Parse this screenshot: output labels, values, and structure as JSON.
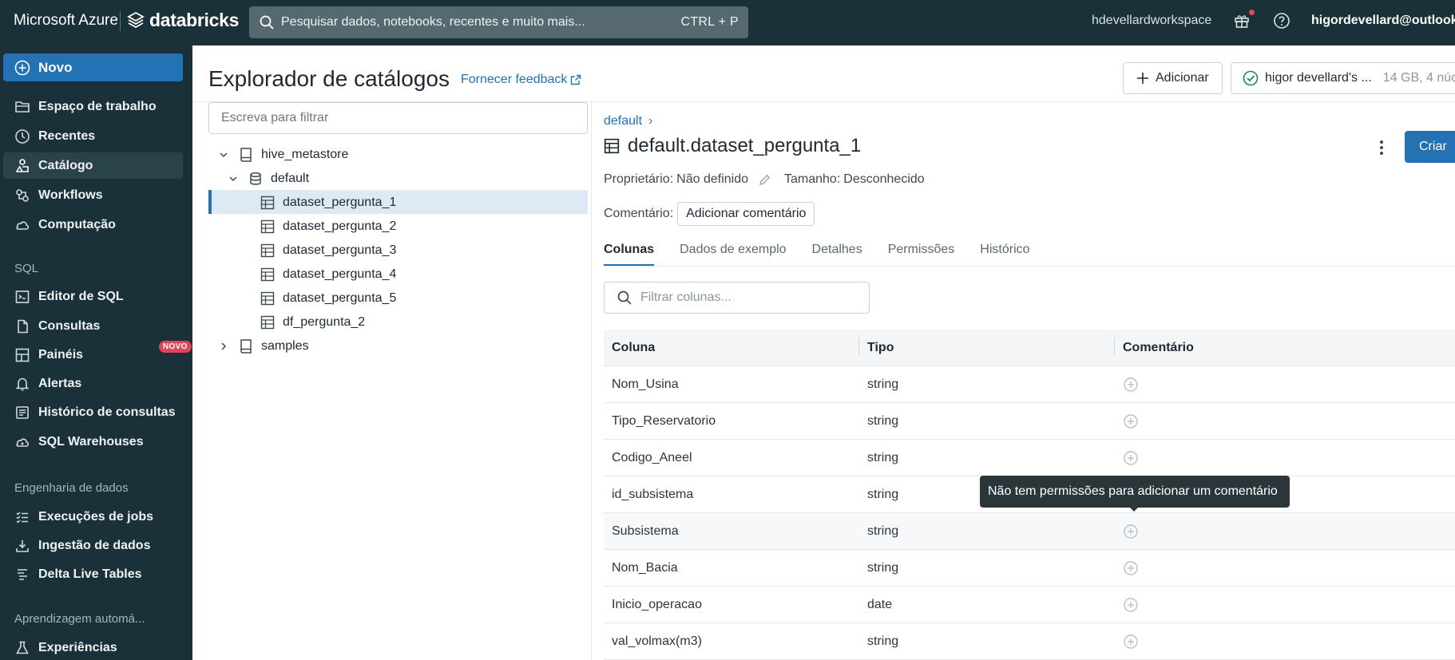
{
  "topbar": {
    "brand_ms": "Microsoft Azure",
    "brand_db": "databricks",
    "search_placeholder": "Pesquisar dados, notebooks, recentes e muito mais...",
    "search_shortcut": "CTRL + P",
    "workspace": "hdevellardworkspace",
    "user": "higordevellard@outlook"
  },
  "sidebar": {
    "new_label": "Novo",
    "items": [
      {
        "label": "Espaço de trabalho",
        "icon": "folder-icon"
      },
      {
        "label": "Recentes",
        "icon": "clock-icon"
      },
      {
        "label": "Catálogo",
        "icon": "catalog-icon",
        "active": true
      },
      {
        "label": "Workflows",
        "icon": "workflows-icon"
      },
      {
        "label": "Computação",
        "icon": "cloud-icon"
      }
    ],
    "sql_section": "SQL",
    "sql_items": [
      {
        "label": "Editor de SQL",
        "icon": "sql-editor-icon"
      },
      {
        "label": "Consultas",
        "icon": "file-icon"
      },
      {
        "label": "Painéis",
        "icon": "dashboard-icon",
        "badge": "NOVO"
      },
      {
        "label": "Alertas",
        "icon": "bell-icon"
      },
      {
        "label": "Histórico de consultas",
        "icon": "history-icon"
      },
      {
        "label": "SQL Warehouses",
        "icon": "warehouse-icon"
      }
    ],
    "de_section": "Engenharia de dados",
    "de_items": [
      {
        "label": "Execuções de jobs",
        "icon": "jobs-icon"
      },
      {
        "label": "Ingestão de dados",
        "icon": "ingest-icon"
      },
      {
        "label": "Delta Live Tables",
        "icon": "delta-icon"
      }
    ],
    "ml_section": "Aprendizagem automá...",
    "ml_items": [
      {
        "label": "Experiências",
        "icon": "flask-icon"
      }
    ]
  },
  "page": {
    "title": "Explorador de catálogos",
    "feedback": "Fornecer feedback",
    "add_button": "Adicionar",
    "cluster_name": "higor devellard's ...",
    "cluster_size": "14 GB, 4 núc"
  },
  "tree": {
    "filter_placeholder": "Escreva para filtrar",
    "nodes": [
      {
        "label": "hive_metastore"
      },
      {
        "label": "default"
      },
      {
        "label": "dataset_pergunta_1"
      },
      {
        "label": "dataset_pergunta_2"
      },
      {
        "label": "dataset_pergunta_3"
      },
      {
        "label": "dataset_pergunta_4"
      },
      {
        "label": "dataset_pergunta_5"
      },
      {
        "label": "df_pergunta_2"
      },
      {
        "label": "samples"
      }
    ]
  },
  "detail": {
    "breadcrumb": "default",
    "breadcrumb_sep": "›",
    "table_name": "default.dataset_pergunta_1",
    "create_button": "Criar",
    "owner_label": "Proprietário:",
    "owner_value": "Não definido",
    "size_label": "Tamanho:",
    "size_value": "Desconhecido",
    "comment_label": "Comentário:",
    "comment_button": "Adicionar comentário",
    "tabs": [
      "Colunas",
      "Dados de exemplo",
      "Detalhes",
      "Permissões",
      "Histórico"
    ],
    "column_filter_placeholder": "Filtrar colunas...",
    "columns_header": {
      "col": "Coluna",
      "type": "Tipo",
      "comment": "Comentário"
    },
    "columns": [
      {
        "name": "Nom_Usina",
        "type": "string"
      },
      {
        "name": "Tipo_Reservatorio",
        "type": "string"
      },
      {
        "name": "Codigo_Aneel",
        "type": "string"
      },
      {
        "name": "id_subsistema",
        "type": "string"
      },
      {
        "name": "Subsistema",
        "type": "string"
      },
      {
        "name": "Nom_Bacia",
        "type": "string"
      },
      {
        "name": "Inicio_operacao",
        "type": "date"
      },
      {
        "name": "val_volmax(m3)",
        "type": "string"
      }
    ],
    "tooltip": "Não tem permissões para adicionar um comentário"
  },
  "colors": {
    "topbar_bg": "#1b3139",
    "accent": "#2272b4",
    "badge": "#e0455a"
  }
}
